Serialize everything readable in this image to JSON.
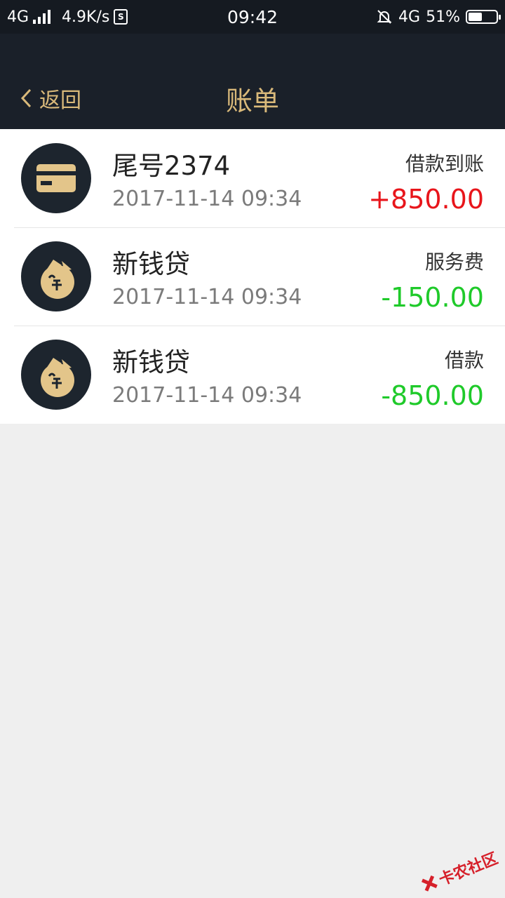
{
  "status_bar": {
    "network_left": "4G",
    "speed": "4.9K/s",
    "sim_badge": "S",
    "time": "09:42",
    "network_right": "4G",
    "battery": "51%",
    "battery_level": 0.51
  },
  "header": {
    "back_label": "返回",
    "title": "账单",
    "accent_color": "#d9b97a",
    "background": "#1a2029"
  },
  "bills": [
    {
      "name": "尾号2374",
      "time": "2017-11-14 09:34",
      "type": "借款到账",
      "amount": "+850.00",
      "amount_color": "#e8151b",
      "icon": "bank-card-icon"
    },
    {
      "name": "新钱贷",
      "time": "2017-11-14 09:34",
      "type": "服务费",
      "amount": "-150.00",
      "amount_color": "#1fca2a",
      "icon": "money-bag-logo-icon"
    },
    {
      "name": "新钱贷",
      "time": "2017-11-14 09:34",
      "type": "借款",
      "amount": "-850.00",
      "amount_color": "#1fca2a",
      "icon": "money-bag-logo-icon"
    }
  ],
  "watermark": "卡农社区"
}
